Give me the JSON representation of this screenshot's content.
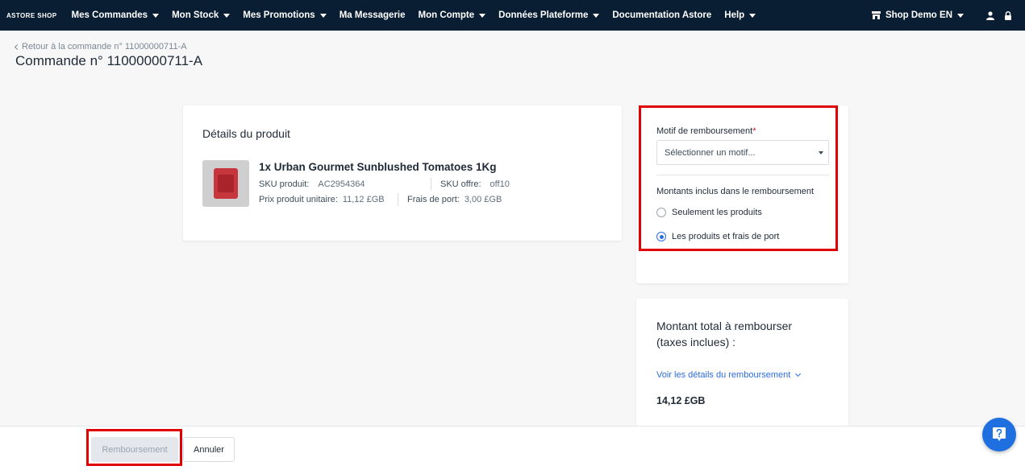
{
  "nav": {
    "brand": "ASTORE SHOP",
    "items": [
      {
        "label": "Mes Commandes",
        "has_caret": true
      },
      {
        "label": "Mon Stock",
        "has_caret": true
      },
      {
        "label": "Mes Promotions",
        "has_caret": true
      },
      {
        "label": "Ma Messagerie",
        "has_caret": false
      },
      {
        "label": "Mon Compte",
        "has_caret": true
      },
      {
        "label": "Données Plateforme",
        "has_caret": true
      },
      {
        "label": "Documentation Astore",
        "has_caret": false
      },
      {
        "label": "Help",
        "has_caret": true
      }
    ],
    "shop_label": "Shop Demo EN",
    "icons": [
      "store-icon",
      "user-icon",
      "lock-icon"
    ]
  },
  "header": {
    "back_link": "Retour à la commande n° 11000000711-A",
    "title": "Commande n° 11000000711-A"
  },
  "product": {
    "section_title": "Détails du produit",
    "name": "1x Urban Gourmet Sunblushed Tomatoes 1Kg",
    "sku_label": "SKU produit:",
    "sku_value": "AC2954364",
    "offer_label": "SKU offre:",
    "offer_value": "off10",
    "unit_price_label": "Prix produit unitaire:",
    "unit_price_value": "11,12 £GB",
    "shipping_label": "Frais de port:",
    "shipping_value": "3,00 £GB"
  },
  "refund_form": {
    "reason_label": "Motif de remboursement",
    "required_mark": "*",
    "reason_placeholder": "Sélectionner un motif...",
    "amounts_label": "Montants inclus dans le remboursement",
    "options": [
      {
        "label": "Seulement les produits",
        "selected": false
      },
      {
        "label": "Les produits et frais de port",
        "selected": true
      }
    ]
  },
  "total": {
    "title": "Montant total à rembourser (taxes inclues) :",
    "details_link": "Voir les détails du remboursement",
    "amount": "14,12 £GB"
  },
  "footer": {
    "refund_button": "Remboursement",
    "cancel_button": "Annuler"
  },
  "colors": {
    "nav_bg": "#0a1e33",
    "accent": "#2b6de0",
    "highlight": "#e10000"
  }
}
